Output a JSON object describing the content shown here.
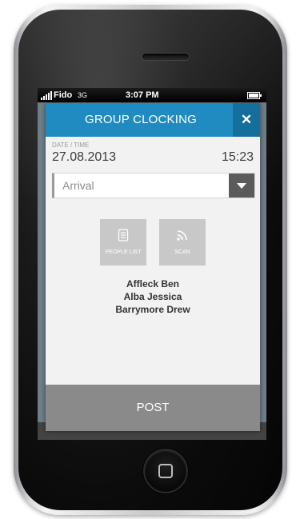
{
  "status_bar": {
    "carrier": "Fido",
    "network": "3G",
    "time": "3:07 PM",
    "signal_icon": "signal-bars-icon",
    "battery_icon": "battery-icon"
  },
  "modal": {
    "title": "GROUP CLOCKING",
    "close_label": "✕",
    "header_color": "#1f8bc0",
    "date_label": "DATE / TIME",
    "date": "27.08.2013",
    "time": "15:23",
    "type_select": {
      "value": "Arrival",
      "arrow_icon": "chevron-down-icon"
    },
    "tiles": [
      {
        "label": "PEOPLE LIST",
        "icon": "document-list-icon"
      },
      {
        "label": "SCAN",
        "icon": "wireless-scan-icon"
      }
    ],
    "people": [
      "Affleck Ben",
      "Alba Jessica",
      "Barrymore Drew"
    ],
    "post_label": "POST"
  }
}
